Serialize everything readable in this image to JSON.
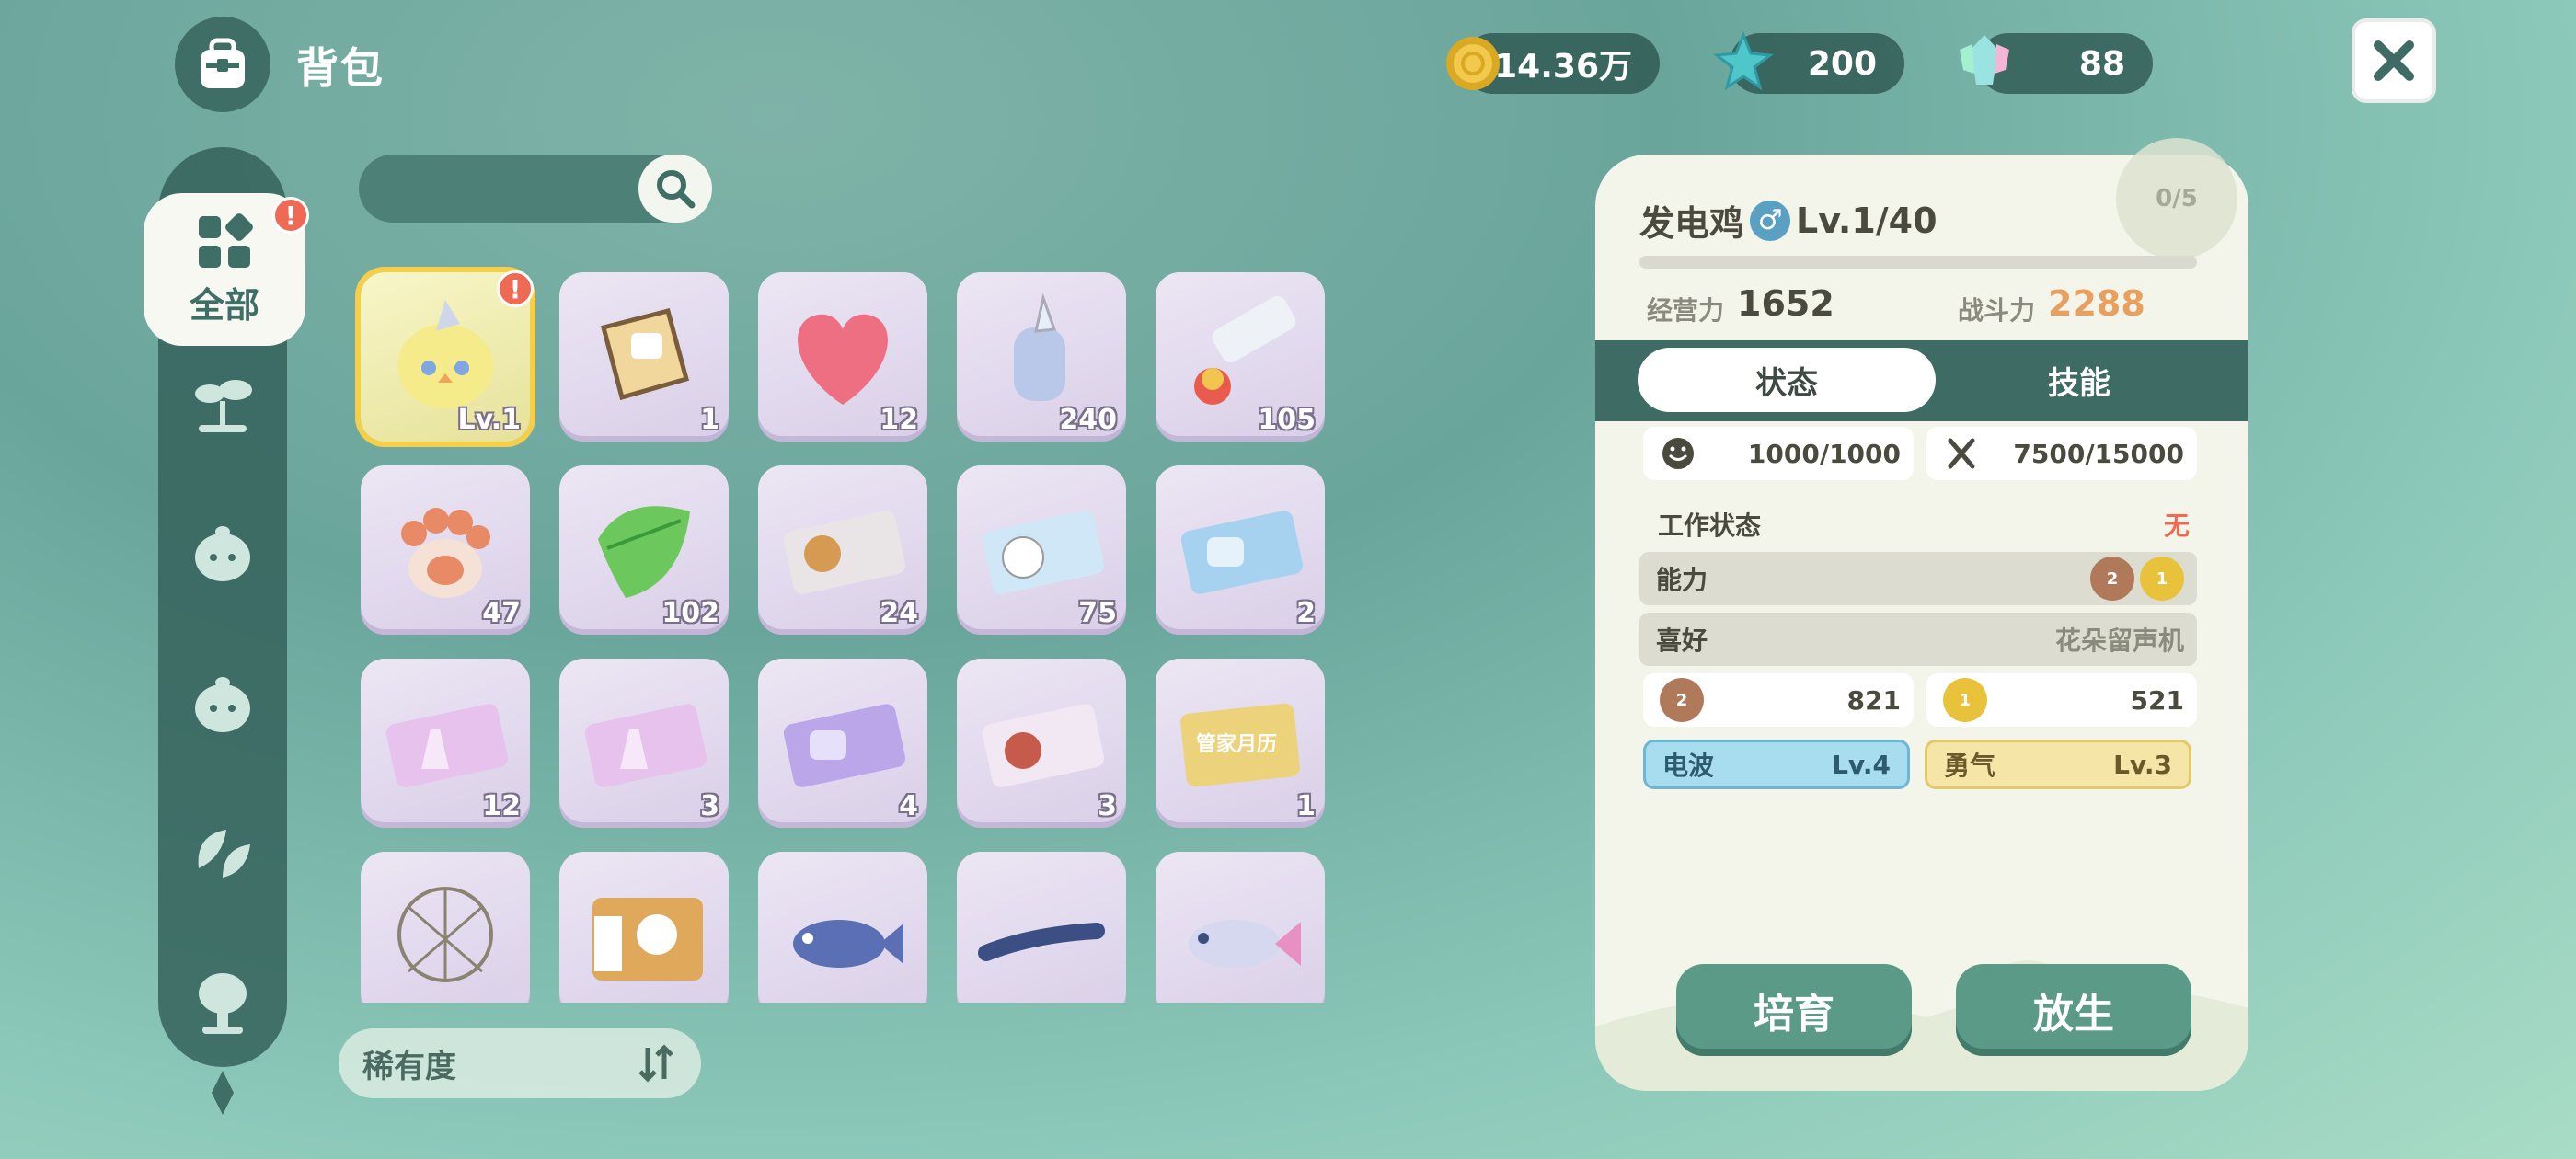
{
  "header": {
    "title": "背包"
  },
  "currencies": [
    {
      "icon": "gold-coin-icon",
      "value": "14.36万"
    },
    {
      "icon": "blue-star-icon",
      "value": "200"
    },
    {
      "icon": "crystal-icon",
      "value": "88"
    }
  ],
  "categories": {
    "active_label": "全部",
    "alert": "!",
    "items": [
      "sprout-icon",
      "bun-icon",
      "bun-alt-icon",
      "leaf-icon",
      "tree-icon"
    ]
  },
  "grid": {
    "items": [
      {
        "icon": "chick-pet-icon",
        "count": "Lv.1",
        "selected": true,
        "alert": "!"
      },
      {
        "icon": "cat-box-icon",
        "count": "1"
      },
      {
        "icon": "heart-icon",
        "count": "12"
      },
      {
        "icon": "horn-candy-icon",
        "count": "240"
      },
      {
        "icon": "tube-icon",
        "count": "105"
      },
      {
        "icon": "paw-icon",
        "count": "47"
      },
      {
        "icon": "green-leaf-icon",
        "count": "102"
      },
      {
        "icon": "ticket-brown-icon",
        "count": "24"
      },
      {
        "icon": "ticket-blue-sheep-icon",
        "count": "75"
      },
      {
        "icon": "ticket-blue-sofa-icon",
        "count": "2"
      },
      {
        "icon": "ticket-pink-dress-icon",
        "count": "12"
      },
      {
        "icon": "ticket-pink-dress-alt-icon",
        "count": "3"
      },
      {
        "icon": "ticket-purple-sofa-icon",
        "count": "4"
      },
      {
        "icon": "ticket-helmet-icon",
        "count": "3"
      },
      {
        "icon": "gold-card-icon",
        "count": "1",
        "card_text": "管家月历"
      },
      {
        "icon": "net-icon",
        "count": ""
      },
      {
        "icon": "piano-ticket-icon",
        "count": ""
      },
      {
        "icon": "blue-fish-icon",
        "count": ""
      },
      {
        "icon": "eel-icon",
        "count": ""
      },
      {
        "icon": "tuna-icon",
        "count": ""
      }
    ]
  },
  "sort": {
    "label": "稀有度",
    "icon": "sort-icon"
  },
  "detail": {
    "name": "发电鸡",
    "gender": "♂",
    "level": "Lv.1/40",
    "fruit_count": "0/5",
    "business_label": "经营力",
    "business_value": "1652",
    "combat_label": "战斗力",
    "combat_value": "2288",
    "tabs": {
      "active": "状态",
      "inactive": "技能"
    },
    "mood": "1000/1000",
    "food": "7500/15000",
    "work_label": "工作状态",
    "work_value": "无",
    "ability_label": "能力",
    "ability_badges": [
      "2",
      "1"
    ],
    "like_label": "喜好",
    "like_value": "花朵留声机",
    "attr1_level": "2",
    "attr1_value": "821",
    "attr2_level": "1",
    "attr2_value": "521",
    "trait1_name": "电波",
    "trait1_level": "Lv.4",
    "trait2_name": "勇气",
    "trait2_level": "Lv.3",
    "btn_cultivate": "培育",
    "btn_release": "放生"
  },
  "colors": {
    "accent": "#3e6b63",
    "combat": "#e8a060",
    "alert": "#ef6a55",
    "button": "#5a9a86",
    "trait_blue": "#a8dcef",
    "trait_yellow": "#f5e6a8"
  }
}
